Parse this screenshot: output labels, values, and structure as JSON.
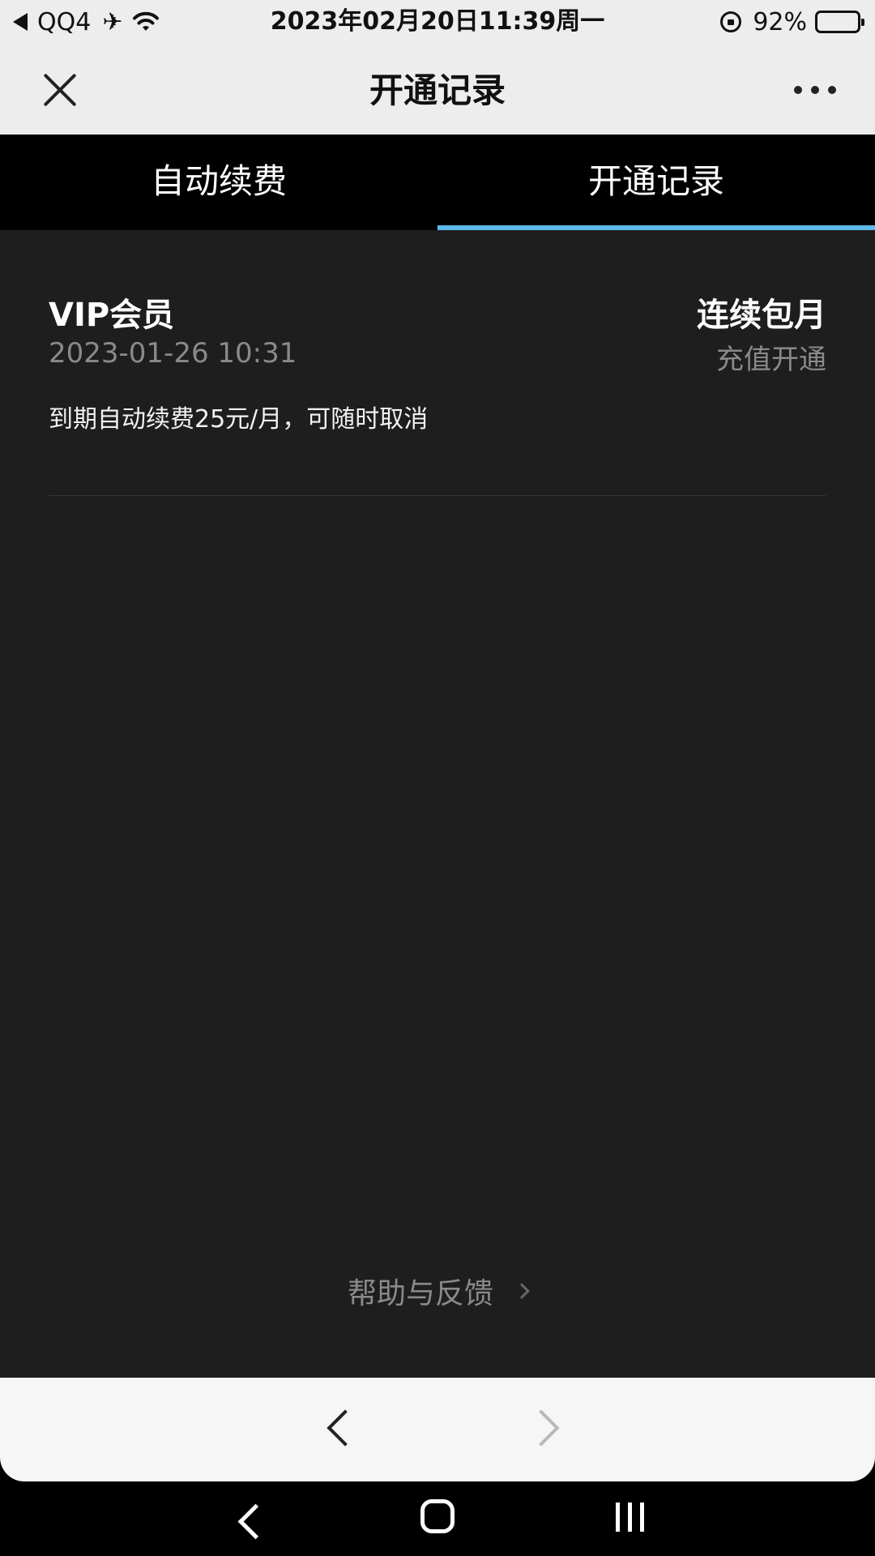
{
  "status_bar": {
    "back_app": "QQ4",
    "datetime": "2023年02月20日11:39周一",
    "battery": "92%",
    "battery_level": 0.92
  },
  "header": {
    "title": "开通记录"
  },
  "tabs": [
    {
      "label": "自动续费",
      "active": false
    },
    {
      "label": "开通记录",
      "active": true
    }
  ],
  "record": {
    "name": "VIP会员",
    "time": "2023-01-26 10:31",
    "type": "连续包月",
    "method": "充值开通",
    "description": "到期自动续费25元/月，可随时取消"
  },
  "help": {
    "label": "帮助与反馈"
  },
  "colors": {
    "tab_indicator": "#5bb8e8",
    "background": "#1e1e1e"
  }
}
